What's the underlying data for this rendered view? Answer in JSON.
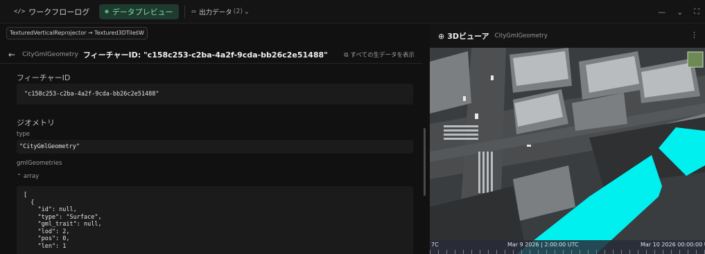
{
  "topbar": {
    "workflow_tab": "ワークフローログ",
    "workflow_icon": "code-icon",
    "preview_tab": "データプレビュー",
    "preview_icon": "eye-icon",
    "output_tab": "出力データ",
    "output_count": "(2)",
    "output_icon": "folder-icon",
    "window_controls": [
      "minimize-icon",
      "chevron-down-icon",
      "fullscreen-icon"
    ],
    "accent_color": "#58d38c"
  },
  "left": {
    "selector_value": "TexturedVerticalReprojector → Textured3DTilesW",
    "feature_type": "CityGmlGeometry",
    "feature_title": "フィーチャーID: \"c158c253-c2ba-4a2f-9cda-bb26c2e51488\"",
    "raw_link": "すべての生データを表示",
    "feature_id_section": "フィーチャーID",
    "feature_id_value": "\"c158c253-c2ba-4a2f-9cda-bb26c2e51488\"",
    "geometry_section": "ジオメトリ",
    "type_label": "type",
    "type_value": "\"CityGmlGeometry\"",
    "gml_label": "gmlGeometries",
    "array_label": "array",
    "json_lines": [
      "[",
      "  {",
      "    \"id\": null,",
      "    \"type\": \"Surface\",",
      "    \"gml_trait\": null,",
      "    \"lod\": 2,",
      "    \"pos\": 0,",
      "    \"len\": 1"
    ]
  },
  "right": {
    "viewer_title": "3Dビューア",
    "viewer_subtitle": "CityGmlGeometry",
    "highlight_color": "#00f0f0",
    "timeline": {
      "start": "7C",
      "current": "Mar 9 2026 | 2:00:00 UTC",
      "end": "Mar 10 2026 00:00:00 U"
    }
  }
}
